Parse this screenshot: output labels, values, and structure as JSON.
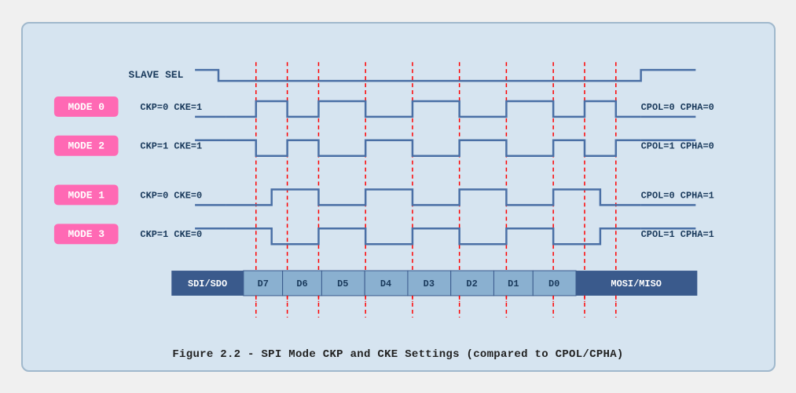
{
  "title": "SPI Mode CKP and CKE Settings",
  "caption": "Figure 2.2 - SPI Mode CKP and CKE Settings (compared to CPOL/CPHA)",
  "modes": [
    {
      "label": "MODE 0",
      "params": "CKP=0  CKE=1",
      "cpol_cpha": "CPOL=0  CPHA=0"
    },
    {
      "label": "MODE 2",
      "params": "CKP=1  CKE=1",
      "cpol_cpha": "CPOL=1  CPHA=0"
    },
    {
      "label": "MODE 1",
      "params": "CKP=0  CKE=0",
      "cpol_cpha": "CPOL=0  CPHA=1"
    },
    {
      "label": "MODE 3",
      "params": "CKP=1  CKE=0",
      "cpol_cpha": "CPOL=1  CPHA=1"
    }
  ],
  "data_labels": [
    "SDI/SDO",
    "D7",
    "D6",
    "D5",
    "D4",
    "D3",
    "D2",
    "D1",
    "D0",
    "MOSI/MISO"
  ],
  "slave_sel_label": "SLAVE SEL",
  "colors": {
    "mode_bg": "#ff69b4",
    "mode_text": "#ffffff",
    "wave_stroke": "#4a6fa5",
    "dashed_stroke": "#ff0000",
    "data_bar_bg": "#3a5a8c",
    "data_bar_text": "#ffffff",
    "data_cell_bg": "#8ab0d0",
    "data_cell_text": "#1a3a5c"
  }
}
